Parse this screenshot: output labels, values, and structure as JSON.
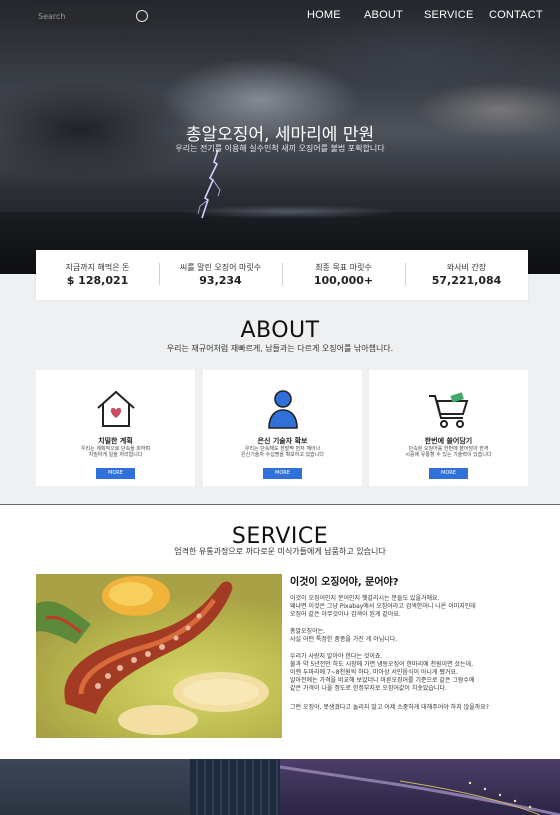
{
  "header": {
    "search_placeholder": "Search",
    "nav": [
      "HOME",
      "ABOUT",
      "SERVICE",
      "CONTACT"
    ]
  },
  "hero": {
    "title": "총알오징어, 세마리에 만원",
    "subtitle": "우리는 전기를 이용해 실수인척 새끼 오징어를 불법 포획합니다"
  },
  "stats": [
    {
      "label": "지금까지 해먹은 돈",
      "value": "$ 128,021"
    },
    {
      "label": "씨를 말린 오징어 마릿수",
      "value": "93,234"
    },
    {
      "label": "최종 목표 마릿수",
      "value": "100,000+"
    },
    {
      "label": "와사비 간장",
      "value": "57,221,084"
    }
  ],
  "about": {
    "title": "ABOUT",
    "subtitle": "우리는 재규어처럼 재빠르게, 남들과는 다르게 오징어를 낚아챕니다.",
    "cards": [
      {
        "icon": "house-heart-icon",
        "title": "치밀한 계획",
        "text": "우리는 계획적으로 단속을 피하며\n치밀하게 일을 처리합니다",
        "button": "MORE"
      },
      {
        "icon": "person-icon",
        "title": "은신 기술자 확보",
        "text": "우리는 단속해도 한발짝 먼저 깨어나\n은신기술자 수십명을 확보하고 있습니다",
        "button": "MORE"
      },
      {
        "icon": "shopping-cart-icon",
        "title": "한번에 쓸어담기",
        "text": "단속된 오징어를 한번에 쓸어담아 한꺼\n시중에 유통할 수 있는 기술력이 있습니다",
        "button": "MORE"
      }
    ]
  },
  "service": {
    "title": "SERVICE",
    "subtitle": "엄격한 유통과정으로 까다로운 미식가들에게 납품하고 있습니다",
    "heading": "이것이 오징어야, 문어야?",
    "paragraphs": [
      "이것이 오징어인지 문어인지 헷갈리시는 분들도 있을거에요.\n왜냐면 이것은 그냥 Pixabay에서 오징어라고 검색한어니 나온 이미지인데\n오징어 같은 아무것이나 검색이 된게 같아요.",
      "총알오징어는,\n사실 어떤 특정한 품종을 가진 게 아닙니다.",
      "우리가 사랑지 알아야 한다는 것이죠.\n불과 약 5년전만 하도 시장에 가면 냉동오징어 한마리에 천원이면 샀는데,\n이젠 두마리에 7~8천원씩 하다, 미아상 서민음식이 아니게 됐거요.\n알아전에는 가격을 비교해 보았더니 마른오징어를 기준으로 같은 그람수에\n같은 가격이 나올 정도로 한정부지로 오징어값이 치솟았습니다.",
      "그런 오징어, 못생겼다고 놀리지 말고 이제 소중하게 대해주어야 하지 않을까요?"
    ]
  },
  "colors": {
    "accent": "#2f71d9",
    "heart": "#c94f5f",
    "person": "#2f71d9",
    "cart_bill": "#43a86a"
  }
}
